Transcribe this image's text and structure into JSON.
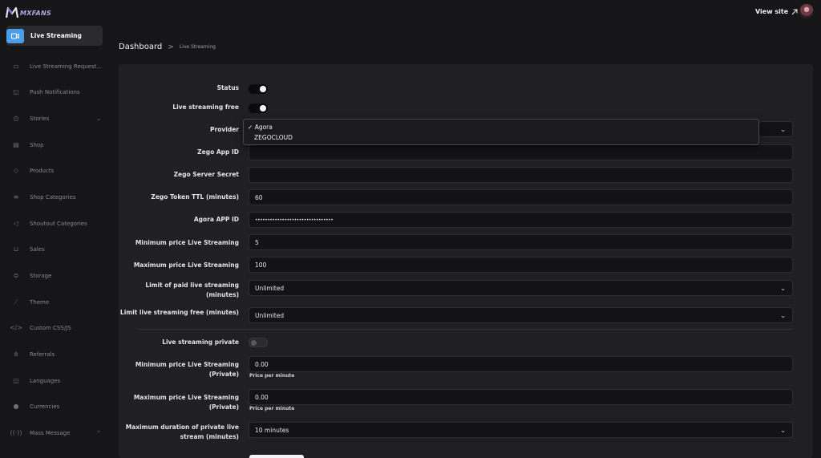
{
  "brand": {
    "name": "MXFANS"
  },
  "header": {
    "view_site": "View site",
    "view_site_icon": "external-arrow-icon",
    "avatar": "user-avatar"
  },
  "sidebar": {
    "items": [
      {
        "label": "Live Streaming",
        "icon": "video-icon",
        "active": true
      },
      {
        "label": "Live Streaming Request...",
        "icon": "monitor-icon"
      },
      {
        "label": "Push Notifications",
        "icon": "notification-icon"
      },
      {
        "label": "Stories",
        "icon": "clock-icon",
        "chevron": "chevron-down"
      },
      {
        "label": "Shop",
        "icon": "shop-icon"
      },
      {
        "label": "Products",
        "icon": "tag-icon"
      },
      {
        "label": "Shop Categories",
        "icon": "list-icon"
      },
      {
        "label": "Shoutout Categories",
        "icon": "megaphone-icon"
      },
      {
        "label": "Sales",
        "icon": "cart-icon"
      },
      {
        "label": "Storage",
        "icon": "database-icon"
      },
      {
        "label": "Theme",
        "icon": "brush-icon"
      },
      {
        "label": "Custom CSS/JS",
        "icon": "code-icon"
      },
      {
        "label": "Referrals",
        "icon": "referrals-icon"
      },
      {
        "label": "Languages",
        "icon": "language-icon"
      },
      {
        "label": "Currencies",
        "icon": "coins-icon"
      },
      {
        "label": "Mass Message",
        "icon": "broadcast-icon",
        "chevron": "chevron-up"
      }
    ]
  },
  "breadcrumb": {
    "home": "Dashboard",
    "separator": ">",
    "current": "Live Streaming"
  },
  "form": {
    "status": {
      "label": "Status",
      "value": "on"
    },
    "live_free": {
      "label": "Live streaming free",
      "value": "on"
    },
    "provider": {
      "label": "Provider",
      "options": [
        "Agora",
        "ZEGOCLOUD"
      ],
      "selected": "Agora",
      "check": "✓"
    },
    "zego_app_id": {
      "label": "Zego App ID",
      "value": ""
    },
    "zego_server_secret": {
      "label": "Zego Server Secret",
      "value": ""
    },
    "zego_token_ttl": {
      "label": "Zego Token TTL (minutes)",
      "value": "60"
    },
    "agora_app_id": {
      "label": "Agora APP ID",
      "value": "••••••••••••••••••••••••••••••••"
    },
    "min_price": {
      "label": "Minimum price Live Streaming",
      "value": "5"
    },
    "max_price": {
      "label": "Maximum price Live Streaming",
      "value": "100"
    },
    "limit_paid": {
      "label_line1": "Limit of paid live streaming",
      "label_line2": "(minutes)",
      "value": "Unlimited"
    },
    "limit_free": {
      "label": "Limit live streaming free (minutes)",
      "value": "Unlimited"
    },
    "live_private": {
      "label": "Live streaming private",
      "value": "off"
    },
    "min_price_private": {
      "label_line1": "Minimum price Live Streaming",
      "label_line2": "(Private)",
      "value": "0.00",
      "help": "Price per minute"
    },
    "max_price_private": {
      "label_line1": "Maximum price Live Streaming",
      "label_line2": "(Private)",
      "value": "0.00",
      "help": "Price per minute"
    },
    "max_duration_private": {
      "label_line1": "Maximum duration of private live",
      "label_line2": "stream (minutes)",
      "value": "10 minutes"
    }
  },
  "colors": {
    "accent": "#4a9ee8",
    "background": "#161618",
    "panel": "#202022",
    "input": "#131315"
  }
}
